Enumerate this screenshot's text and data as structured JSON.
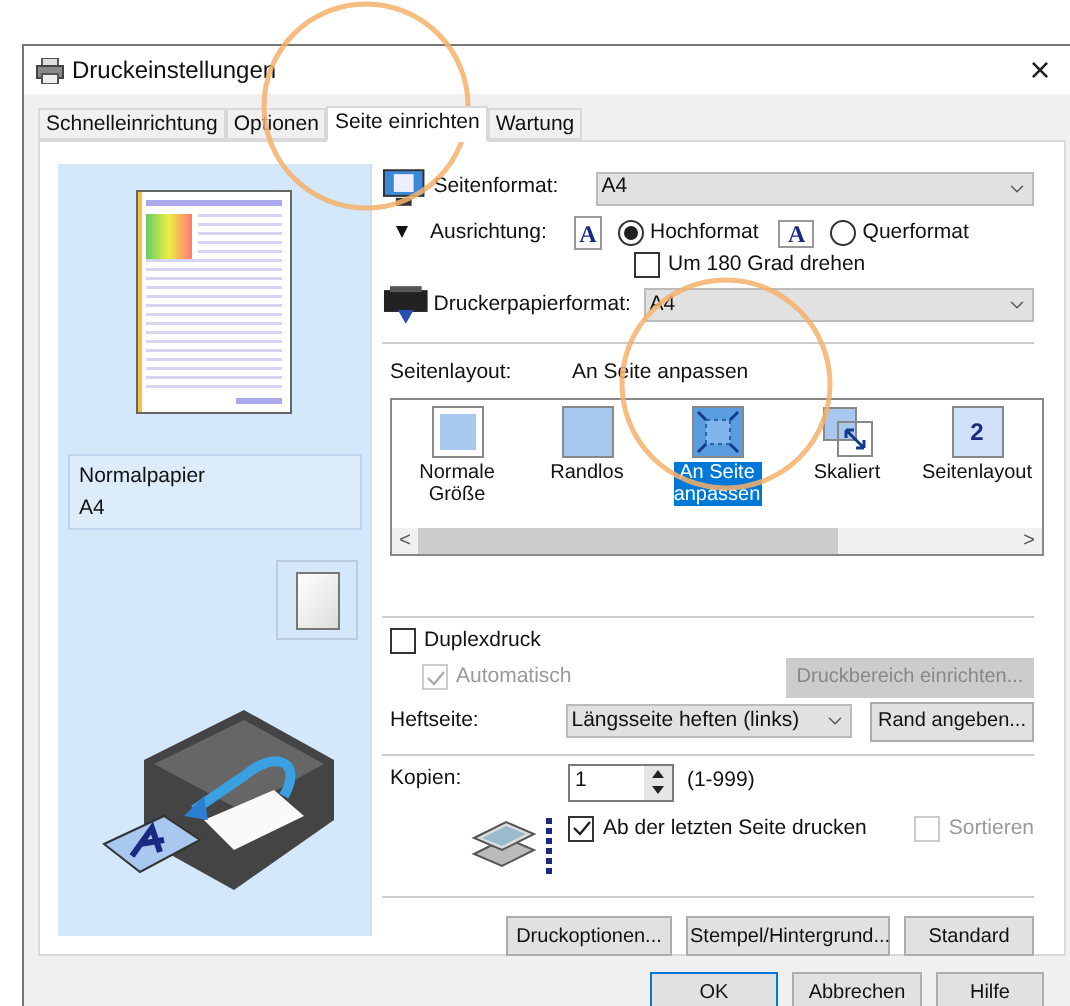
{
  "window": {
    "title": "Druckeinstellungen",
    "close": "×"
  },
  "tabs": [
    {
      "label": "Schnelleinrichtung",
      "selected": false
    },
    {
      "label": "Optionen",
      "selected": false
    },
    {
      "label": "Seite einrichten",
      "selected": true
    },
    {
      "label": "Wartung",
      "selected": false
    }
  ],
  "preview": {
    "media": "Normalpapier",
    "size": "A4"
  },
  "page_size": {
    "label": "Seitenformat:",
    "value": "A4"
  },
  "orientation": {
    "label": "Ausrichtung:",
    "options": [
      {
        "label": "Hochformat",
        "icon_text": "A",
        "selected": true
      },
      {
        "label": "Querformat",
        "icon_text": "A",
        "selected": false
      }
    ],
    "rotate": {
      "label": "Um 180 Grad drehen",
      "checked": false
    }
  },
  "printer_paper_size": {
    "label": "Druckerpapierformat:",
    "value": "A4"
  },
  "page_layout": {
    "label": "Seitenlayout:",
    "value": "An Seite anpassen",
    "options": [
      {
        "kind": "normal",
        "label": "Normale Größe",
        "selected": false
      },
      {
        "kind": "borderless",
        "label": "Randlos",
        "selected": false
      },
      {
        "kind": "fit",
        "label": "An Seite anpassen",
        "selected": true
      },
      {
        "kind": "scaled",
        "label": "Skaliert",
        "selected": false
      },
      {
        "kind": "numbered",
        "label": "Seitenlayout",
        "icon_text": "2",
        "selected": false
      }
    ],
    "scroll_left": "<",
    "scroll_right": ">"
  },
  "duplex": {
    "label": "Duplexdruck",
    "checked": false
  },
  "automatic": {
    "label": "Automatisch",
    "checked": true,
    "disabled": true
  },
  "print_area_button": {
    "label": "Druckbereich einrichten...",
    "disabled": true
  },
  "stapling": {
    "label": "Heftseite:",
    "value": "Längsseite heften (links)"
  },
  "margin_button": {
    "label": "Rand angeben..."
  },
  "copies": {
    "label": "Kopien:",
    "value": "1",
    "range": "(1-999)"
  },
  "reverse": {
    "label": "Ab der letzten Seite drucken",
    "checked": true
  },
  "collate": {
    "label": "Sortieren",
    "checked": false,
    "disabled": true
  },
  "panel_buttons": [
    "Druckoptionen...",
    "Stempel/Hintergrund...",
    "Standard"
  ],
  "dialog_buttons": [
    {
      "label": "OK",
      "default": true
    },
    {
      "label": "Abbrechen",
      "default": false
    },
    {
      "label": "Hilfe",
      "default": false
    }
  ]
}
